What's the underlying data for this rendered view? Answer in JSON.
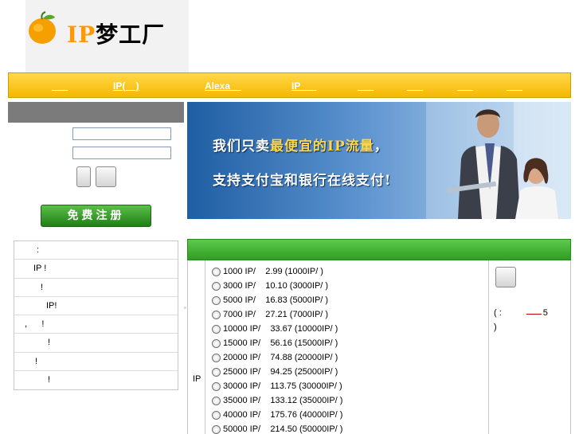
{
  "logo": {
    "text_ip": "IP",
    "text_cn": "梦工厂"
  },
  "nav": {
    "items": [
      "___",
      "IP(__)",
      "Alexa__",
      "IP___",
      "___",
      "___",
      "___",
      "___"
    ]
  },
  "login": {
    "username_value": "",
    "password_value": ""
  },
  "register": {
    "label": "免费注册"
  },
  "banner": {
    "line1_pre": "我们只卖",
    "line1_hl": "最便宜的IP流量",
    "line1_post": "，",
    "line2": "支持支付宝和银行在线支付!"
  },
  "news": {
    "items": [
      ":",
      "IP !",
      "!",
      "IP!",
      ",      !",
      "!",
      "!",
      "!"
    ]
  },
  "order": {
    "label": "IP",
    "options": [
      "1000 IP/    2.99 (1000IP/ )",
      "3000 IP/    10.10 (3000IP/ )",
      "5000 IP/    16.83 (5000IP/ )",
      "7000 IP/    27.21 (7000IP/ )",
      "10000 IP/    33.67 (10000IP/ )",
      "15000 IP/    56.16 (15000IP/ )",
      "20000 IP/    74.88 (20000IP/ )",
      "25000 IP/    94.25 (25000IP/ )",
      "30000 IP/    113.75 (30000IP/ )",
      "35000 IP/    133.12 (35000IP/ )",
      "40000 IP/    175.76 (40000IP/ )",
      "50000 IP/    214.50 (50000IP/ )"
    ],
    "note_line1": "( :                 5",
    "note_line2": ")"
  },
  "colors": {
    "nav_yellow": "#f6b800",
    "green": "#2e9e22",
    "panel_gray": "#7b7b7b"
  }
}
